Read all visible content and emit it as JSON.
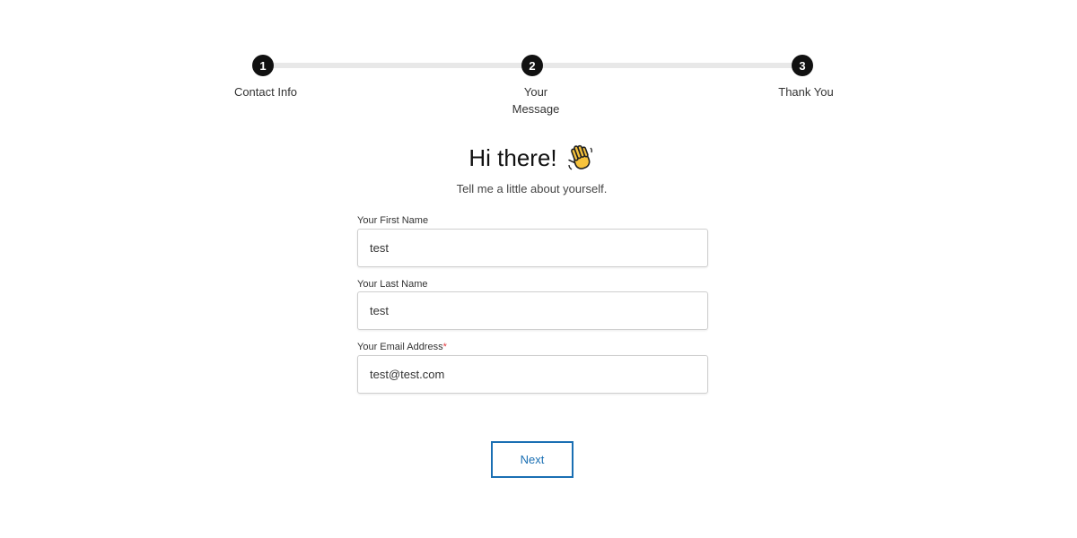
{
  "stepper": {
    "steps": [
      {
        "number": "1",
        "label": "Contact Info"
      },
      {
        "number": "2",
        "label_line1": "Your",
        "label_line2": "Message"
      },
      {
        "number": "3",
        "label": "Thank You"
      }
    ]
  },
  "header": {
    "title": "Hi there!",
    "title_icon": "waving-hand-icon",
    "subtitle": "Tell me a little about yourself."
  },
  "form": {
    "first_name": {
      "label": "Your First Name",
      "value": "test"
    },
    "last_name": {
      "label": "Your Last Name",
      "value": "test"
    },
    "email": {
      "label": "Your Email Address",
      "required_mark": "*",
      "value": "test@test.com"
    }
  },
  "actions": {
    "next_label": "Next"
  },
  "colors": {
    "accent": "#1a6fb3",
    "step_circle": "#111111",
    "required": "#e0393e"
  }
}
